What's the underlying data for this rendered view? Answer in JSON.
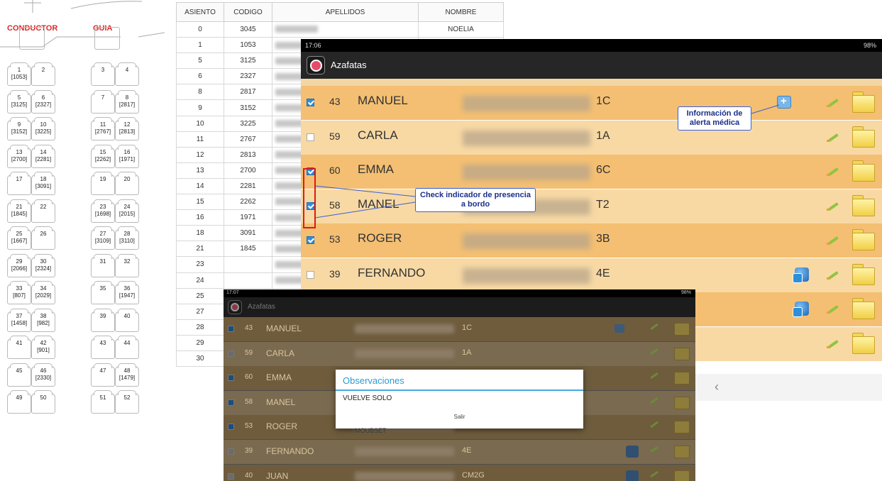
{
  "seatmap": {
    "conductor_label": "CONDUCTOR",
    "guia_label": "GUIA",
    "seats": [
      {
        "num": "1",
        "code": "[1053]"
      },
      {
        "num": "2",
        "code": ""
      },
      {
        "num": "3",
        "code": ""
      },
      {
        "num": "4",
        "code": ""
      },
      {
        "num": "5",
        "code": "[3125]"
      },
      {
        "num": "6",
        "code": "[2327]"
      },
      {
        "num": "7",
        "code": ""
      },
      {
        "num": "8",
        "code": "[2817]"
      },
      {
        "num": "9",
        "code": "[3152]"
      },
      {
        "num": "10",
        "code": "[3225]"
      },
      {
        "num": "11",
        "code": "[2767]"
      },
      {
        "num": "12",
        "code": "[2813]"
      },
      {
        "num": "13",
        "code": "[2700]"
      },
      {
        "num": "14",
        "code": "[2281]"
      },
      {
        "num": "15",
        "code": "[2262]"
      },
      {
        "num": "16",
        "code": "[1971]"
      },
      {
        "num": "17",
        "code": ""
      },
      {
        "num": "18",
        "code": "[3091]"
      },
      {
        "num": "19",
        "code": ""
      },
      {
        "num": "20",
        "code": ""
      },
      {
        "num": "21",
        "code": "[1845]"
      },
      {
        "num": "22",
        "code": ""
      },
      {
        "num": "23",
        "code": "[1698]"
      },
      {
        "num": "24",
        "code": "[2015]"
      },
      {
        "num": "25",
        "code": "[1667]"
      },
      {
        "num": "26",
        "code": ""
      },
      {
        "num": "27",
        "code": "[3109]"
      },
      {
        "num": "28",
        "code": "[3110]"
      },
      {
        "num": "29",
        "code": "[2066]"
      },
      {
        "num": "30",
        "code": "[2324]"
      },
      {
        "num": "31",
        "code": ""
      },
      {
        "num": "32",
        "code": ""
      },
      {
        "num": "33",
        "code": "[807]"
      },
      {
        "num": "34",
        "code": "[2029]"
      },
      {
        "num": "35",
        "code": ""
      },
      {
        "num": "36",
        "code": "[1947]"
      },
      {
        "num": "37",
        "code": "[1458]"
      },
      {
        "num": "38",
        "code": "[982]"
      },
      {
        "num": "39",
        "code": ""
      },
      {
        "num": "40",
        "code": ""
      },
      {
        "num": "41",
        "code": ""
      },
      {
        "num": "42",
        "code": "[901]"
      },
      {
        "num": "43",
        "code": ""
      },
      {
        "num": "44",
        "code": ""
      },
      {
        "num": "45",
        "code": ""
      },
      {
        "num": "46",
        "code": "[2330]"
      },
      {
        "num": "47",
        "code": ""
      },
      {
        "num": "48",
        "code": "[1479]"
      },
      {
        "num": "49",
        "code": ""
      },
      {
        "num": "50",
        "code": ""
      },
      {
        "num": "51",
        "code": ""
      },
      {
        "num": "52",
        "code": ""
      }
    ]
  },
  "table": {
    "headers": [
      "ASIENTO",
      "CODIGO",
      "APELLIDOS",
      "NOMBRE"
    ],
    "rows": [
      [
        "0",
        "3045",
        "",
        "NOELIA"
      ],
      [
        "1",
        "1053",
        "",
        ""
      ],
      [
        "5",
        "3125",
        "",
        ""
      ],
      [
        "6",
        "2327",
        "",
        ""
      ],
      [
        "8",
        "2817",
        "",
        ""
      ],
      [
        "9",
        "3152",
        "",
        ""
      ],
      [
        "10",
        "3225",
        "",
        ""
      ],
      [
        "11",
        "2767",
        "",
        ""
      ],
      [
        "12",
        "2813",
        "",
        ""
      ],
      [
        "13",
        "2700",
        "",
        ""
      ],
      [
        "14",
        "2281",
        "",
        ""
      ],
      [
        "15",
        "2262",
        "",
        ""
      ],
      [
        "16",
        "1971",
        "",
        ""
      ],
      [
        "18",
        "3091",
        "",
        ""
      ],
      [
        "21",
        "1845",
        "",
        ""
      ],
      [
        "23",
        "",
        "",
        ""
      ],
      [
        "24",
        "",
        "",
        ""
      ],
      [
        "25",
        "",
        "",
        ""
      ],
      [
        "27",
        "",
        "",
        ""
      ],
      [
        "28",
        "",
        "",
        ""
      ],
      [
        "29",
        "",
        "",
        ""
      ],
      [
        "30",
        "",
        "",
        ""
      ]
    ]
  },
  "app": {
    "title": "Azafatas",
    "status_time": "17:06",
    "status_right": "98%",
    "rows": [
      {
        "checked": true,
        "seat": "43",
        "name": "MANUEL",
        "loc": "1C",
        "medical": true,
        "group": false
      },
      {
        "checked": false,
        "seat": "59",
        "name": "CARLA",
        "loc": "1A",
        "medical": false,
        "group": false
      },
      {
        "checked": true,
        "seat": "60",
        "name": "EMMA",
        "loc": "6C",
        "medical": false,
        "group": false
      },
      {
        "checked": true,
        "seat": "58",
        "name": "MANEL",
        "loc": "T2",
        "medical": false,
        "group": false
      },
      {
        "checked": true,
        "seat": "53",
        "name": "ROGER",
        "loc": "3B",
        "medical": false,
        "group": false
      },
      {
        "checked": false,
        "seat": "39",
        "name": "FERNANDO",
        "loc": "4E",
        "medical": false,
        "group": true
      },
      {
        "checked": false,
        "seat": "",
        "name": "",
        "loc": "",
        "medical": false,
        "group": true
      },
      {
        "checked": false,
        "seat": "",
        "name": "",
        "loc": "",
        "medical": false,
        "group": false
      }
    ]
  },
  "callouts": {
    "medical": "Información de alerta médica",
    "presence": "Check indicador de presencia a bordo"
  },
  "app2": {
    "title": "Azafatas",
    "status_time": "17:07",
    "status_right": "98%",
    "rows": [
      {
        "checked": true,
        "seat": "43",
        "name": "MANUEL",
        "loc": "1C",
        "medical": true,
        "group": false
      },
      {
        "checked": false,
        "seat": "59",
        "name": "CARLA",
        "loc": "1A",
        "medical": false,
        "group": false
      },
      {
        "checked": true,
        "seat": "60",
        "name": "EMMA",
        "loc": "",
        "medical": false,
        "group": false
      },
      {
        "checked": true,
        "seat": "58",
        "name": "MANEL",
        "loc": "",
        "medical": false,
        "group": false
      },
      {
        "checked": true,
        "seat": "53",
        "name": "ROGER",
        "loc": "",
        "medical": false,
        "group": false
      },
      {
        "checked": false,
        "seat": "39",
        "name": "FERNANDO",
        "loc": "4E",
        "medical": false,
        "group": true
      },
      {
        "checked": false,
        "seat": "40",
        "name": "JUAN",
        "loc": "CM2G",
        "medical": false,
        "group": true
      }
    ]
  },
  "dialog": {
    "title": "Observaciones",
    "text": "VUELVE SOLO",
    "button": "Salir",
    "partial_name": "MOUBSET"
  }
}
